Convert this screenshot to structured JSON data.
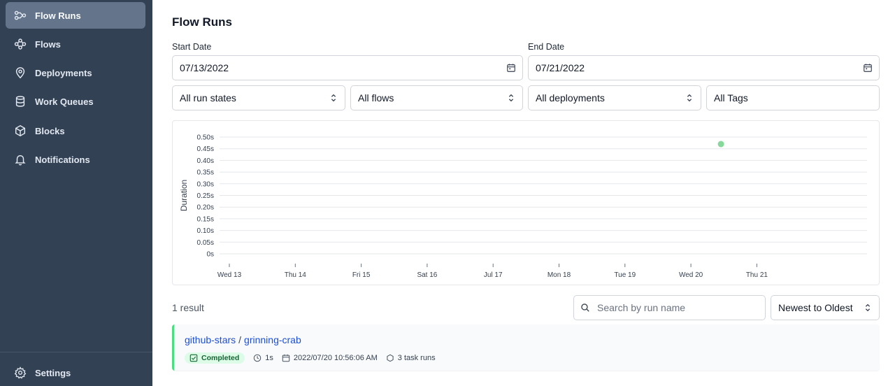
{
  "sidebar": {
    "items": [
      {
        "label": "Flow Runs",
        "icon": "flow-runs-icon",
        "active": true
      },
      {
        "label": "Flows",
        "icon": "flows-icon"
      },
      {
        "label": "Deployments",
        "icon": "map-pin-icon"
      },
      {
        "label": "Work Queues",
        "icon": "database-icon"
      },
      {
        "label": "Blocks",
        "icon": "cube-icon"
      },
      {
        "label": "Notifications",
        "icon": "bell-icon"
      }
    ],
    "settings": {
      "label": "Settings",
      "icon": "gear-icon"
    }
  },
  "page": {
    "title": "Flow Runs"
  },
  "filters": {
    "start_date_label": "Start Date",
    "start_date_value": "07/13/2022",
    "end_date_label": "End Date",
    "end_date_value": "07/21/2022",
    "run_states": "All run states",
    "flows": "All flows",
    "deployments": "All deployments",
    "tags": "All Tags"
  },
  "chart_data": {
    "type": "scatter",
    "ylabel": "Duration",
    "y_ticks": [
      "0s",
      "0.05s",
      "0.10s",
      "0.15s",
      "0.20s",
      "0.25s",
      "0.30s",
      "0.35s",
      "0.40s",
      "0.45s",
      "0.50s"
    ],
    "x_ticks": [
      "Wed 13",
      "Thu 14",
      "Fri 15",
      "Sat 16",
      "Jul 17",
      "Mon 18",
      "Tue 19",
      "Wed 20",
      "Thu 21"
    ],
    "ylim": [
      0,
      0.5
    ],
    "grid": true,
    "points": [
      {
        "x": "2022-07-20T10:56:06",
        "y": 0.47,
        "state": "Completed"
      }
    ],
    "point_color": "#86d99a"
  },
  "results": {
    "count_label": "1 result",
    "search_placeholder": "Search by run name",
    "sort_value": "Newest to Oldest"
  },
  "runs": [
    {
      "flow_name": "github-stars",
      "separator": "/",
      "run_name": "grinning-crab",
      "state": "Completed",
      "duration": "1s",
      "start_time": "2022/07/20 10:56:06 AM",
      "task_runs": "3 task runs"
    }
  ],
  "colors": {
    "sidebar_bg": "#334155",
    "active_item_bg": "#64748b",
    "link": "#1d4ed8",
    "completed_badge_bg": "#dcfce7",
    "completed_accent": "#4ade80"
  }
}
